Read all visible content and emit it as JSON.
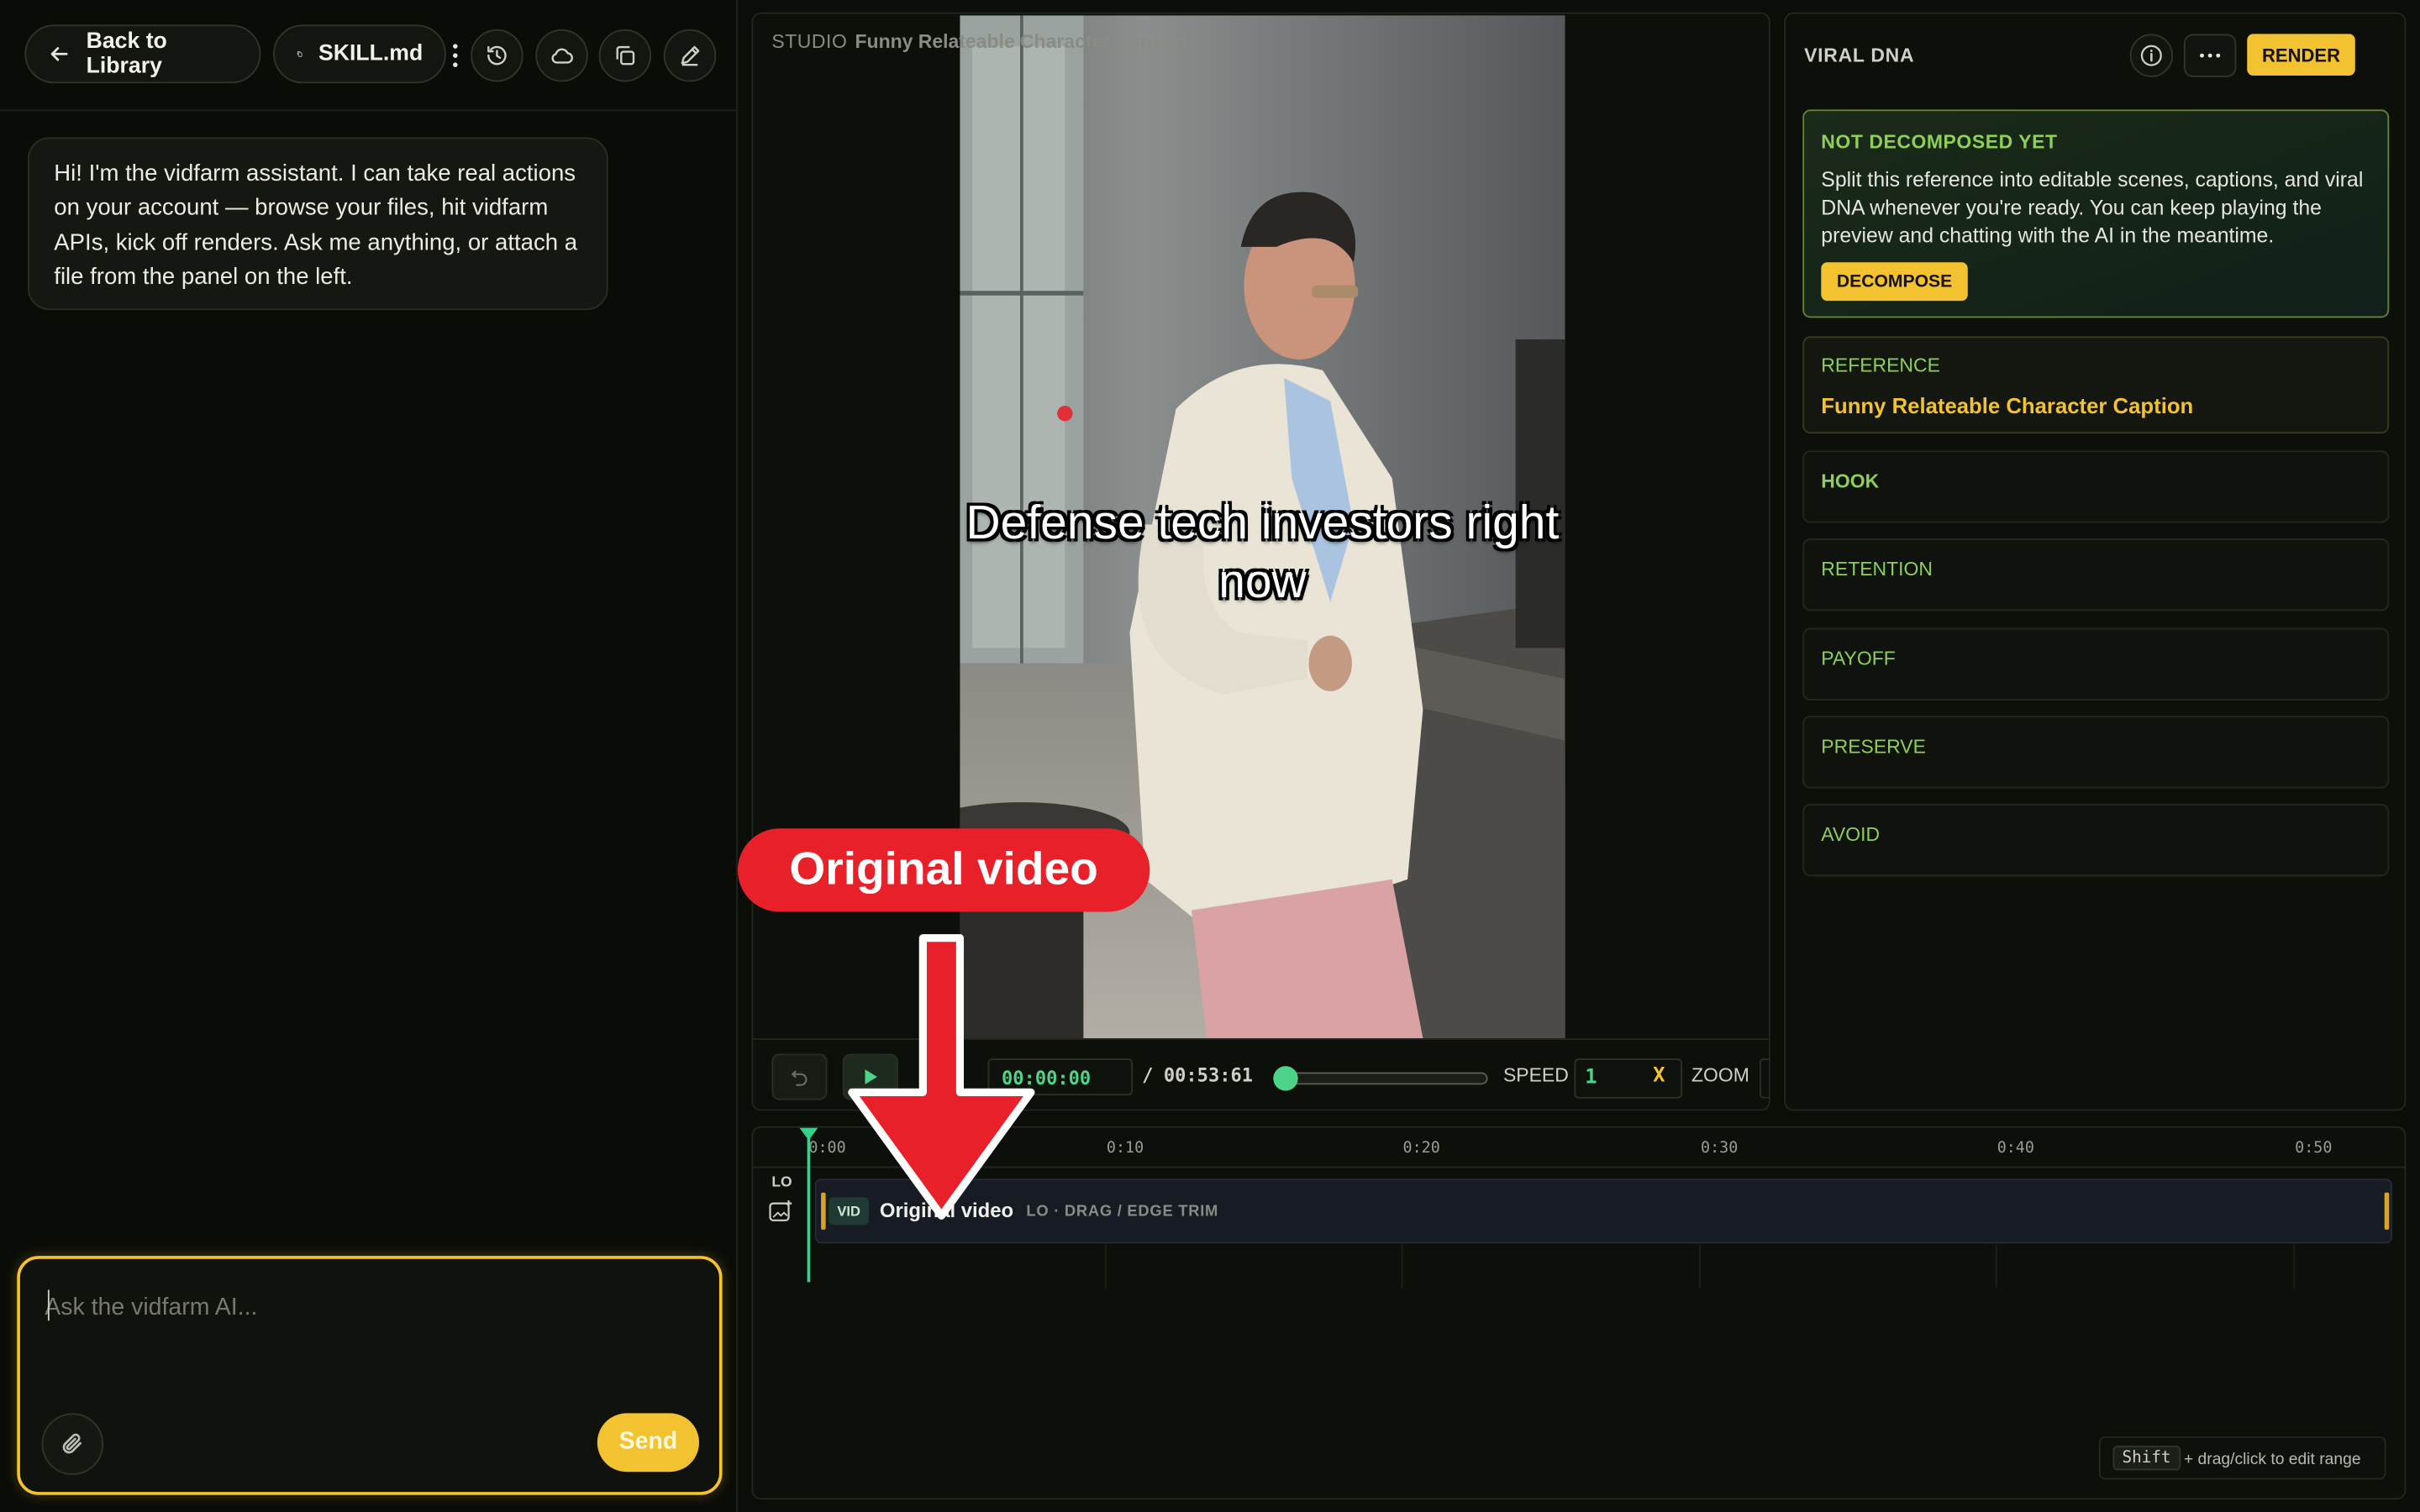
{
  "chat": {
    "back_label": "Back to Library",
    "file_label": "SKILL.md",
    "assistant_message": "Hi! I'm the vidfarm assistant. I can take real actions on your account — browse your files, hit vidfarm APIs, kick off renders. Ask me anything, or attach a file from the panel on the left.",
    "input_placeholder": "Ask the vidfarm AI...",
    "send_label": "Send"
  },
  "studio": {
    "label": "STUDIO",
    "title": "Funny Relateable Character Caption",
    "video_caption": "Defense tech investors right now",
    "time_current": "00:00:00",
    "time_separator": "/",
    "time_total": "00:53:61",
    "speed_label": "SPEED",
    "speed_value": "1",
    "speed_unit": "X",
    "zoom_label": "ZOOM",
    "seek_progress": 0.0
  },
  "dna": {
    "title": "VIRAL DNA",
    "render_label": "RENDER",
    "not_decomposed_heading": "NOT DECOMPOSED YET",
    "not_decomposed_body": "Split this reference into editable scenes, captions, and viral DNA whenever you're ready. You can keep playing the preview and chatting with the AI in the meantime.",
    "decompose_label": "DECOMPOSE",
    "reference_label": "REFERENCE",
    "reference_value": "Funny Relateable Character Caption",
    "sections": [
      "HOOK",
      "RETENTION",
      "PAYOFF",
      "PRESERVE",
      "AVOID"
    ]
  },
  "timeline": {
    "ticks": [
      "0:00",
      "0:10",
      "0:20",
      "0:30",
      "0:40",
      "0:50"
    ],
    "track_label": "LO",
    "clip_badge": "VID",
    "clip_name": "Original video",
    "clip_hint": "LO · DRAG / EDGE TRIM",
    "shift_key": "Shift",
    "shift_hint": "+ drag/click to edit range"
  },
  "annotation": {
    "label": "Original video",
    "color": "#e8202a"
  },
  "colors": {
    "accent": "#f2c230",
    "green": "#8ecf57",
    "playhead": "#2fd38a"
  }
}
